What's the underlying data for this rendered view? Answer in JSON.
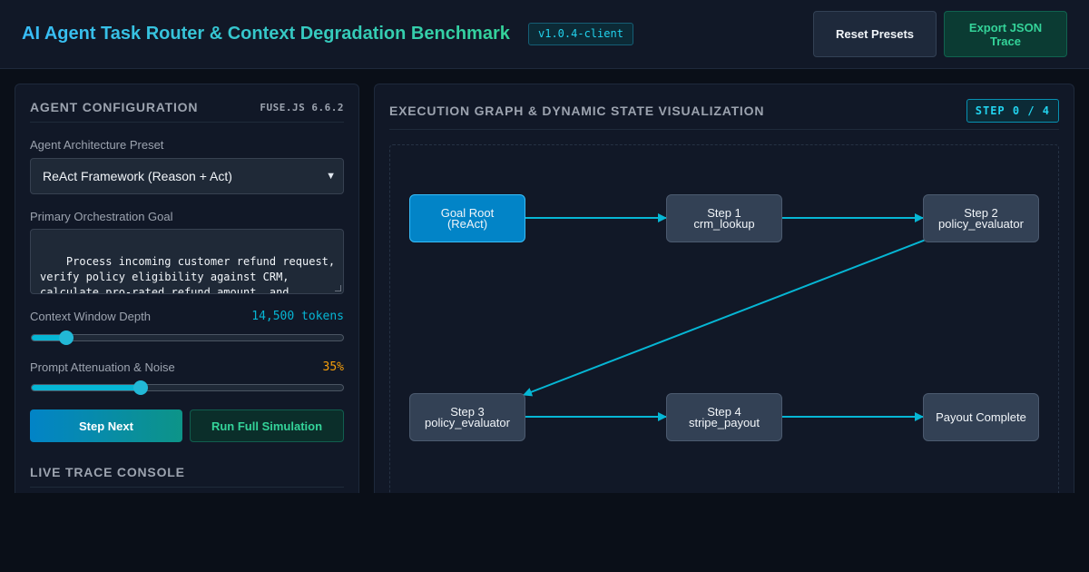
{
  "header": {
    "title": "AI Agent Task Router & Context Degradation Benchmark",
    "version": "v1.0.4-client",
    "reset_label": "Reset Presets",
    "export_label": "Export JSON Trace"
  },
  "config": {
    "title": "AGENT CONFIGURATION",
    "lib_label": "FUSE.JS 6.6.2",
    "preset_label": "Agent Architecture Preset",
    "preset_value": "ReAct Framework (Reason + Act)",
    "goal_label": "Primary Orchestration Goal",
    "goal_value": "Process incoming customer refund request, verify policy eligibility against CRM, calculate pro-rated refund amount, and trigger payout via Stripe API.",
    "context_label": "Context Window Depth",
    "context_value": "14,500 tokens",
    "context_fraction": 0.11,
    "noise_label": "Prompt Attenuation & Noise",
    "noise_value": "35%",
    "noise_fraction": 0.35,
    "step_button": "Step Next",
    "run_button": "Run Full Simulation",
    "console_title": "LIVE TRACE CONSOLE"
  },
  "graph": {
    "title": "EXECUTION GRAPH & DYNAMIC STATE VISUALIZATION",
    "step_badge": "STEP 0 / 4",
    "nodes": [
      {
        "line1": "Goal Root",
        "line2": "(ReAct)"
      },
      {
        "line1": "Step 1",
        "line2": "crm_lookup"
      },
      {
        "line1": "Step 2",
        "line2": "policy_evaluator"
      },
      {
        "line1": "Step 3",
        "line2": "policy_evaluator"
      },
      {
        "line1": "Step 4",
        "line2": "stripe_payout"
      },
      {
        "line1": "Payout Complete",
        "line2": ""
      }
    ]
  },
  "colors": {
    "accent": "#06b6d4",
    "active_node": "#0284c7",
    "success": "#34d399",
    "warning": "#f59e0b"
  }
}
